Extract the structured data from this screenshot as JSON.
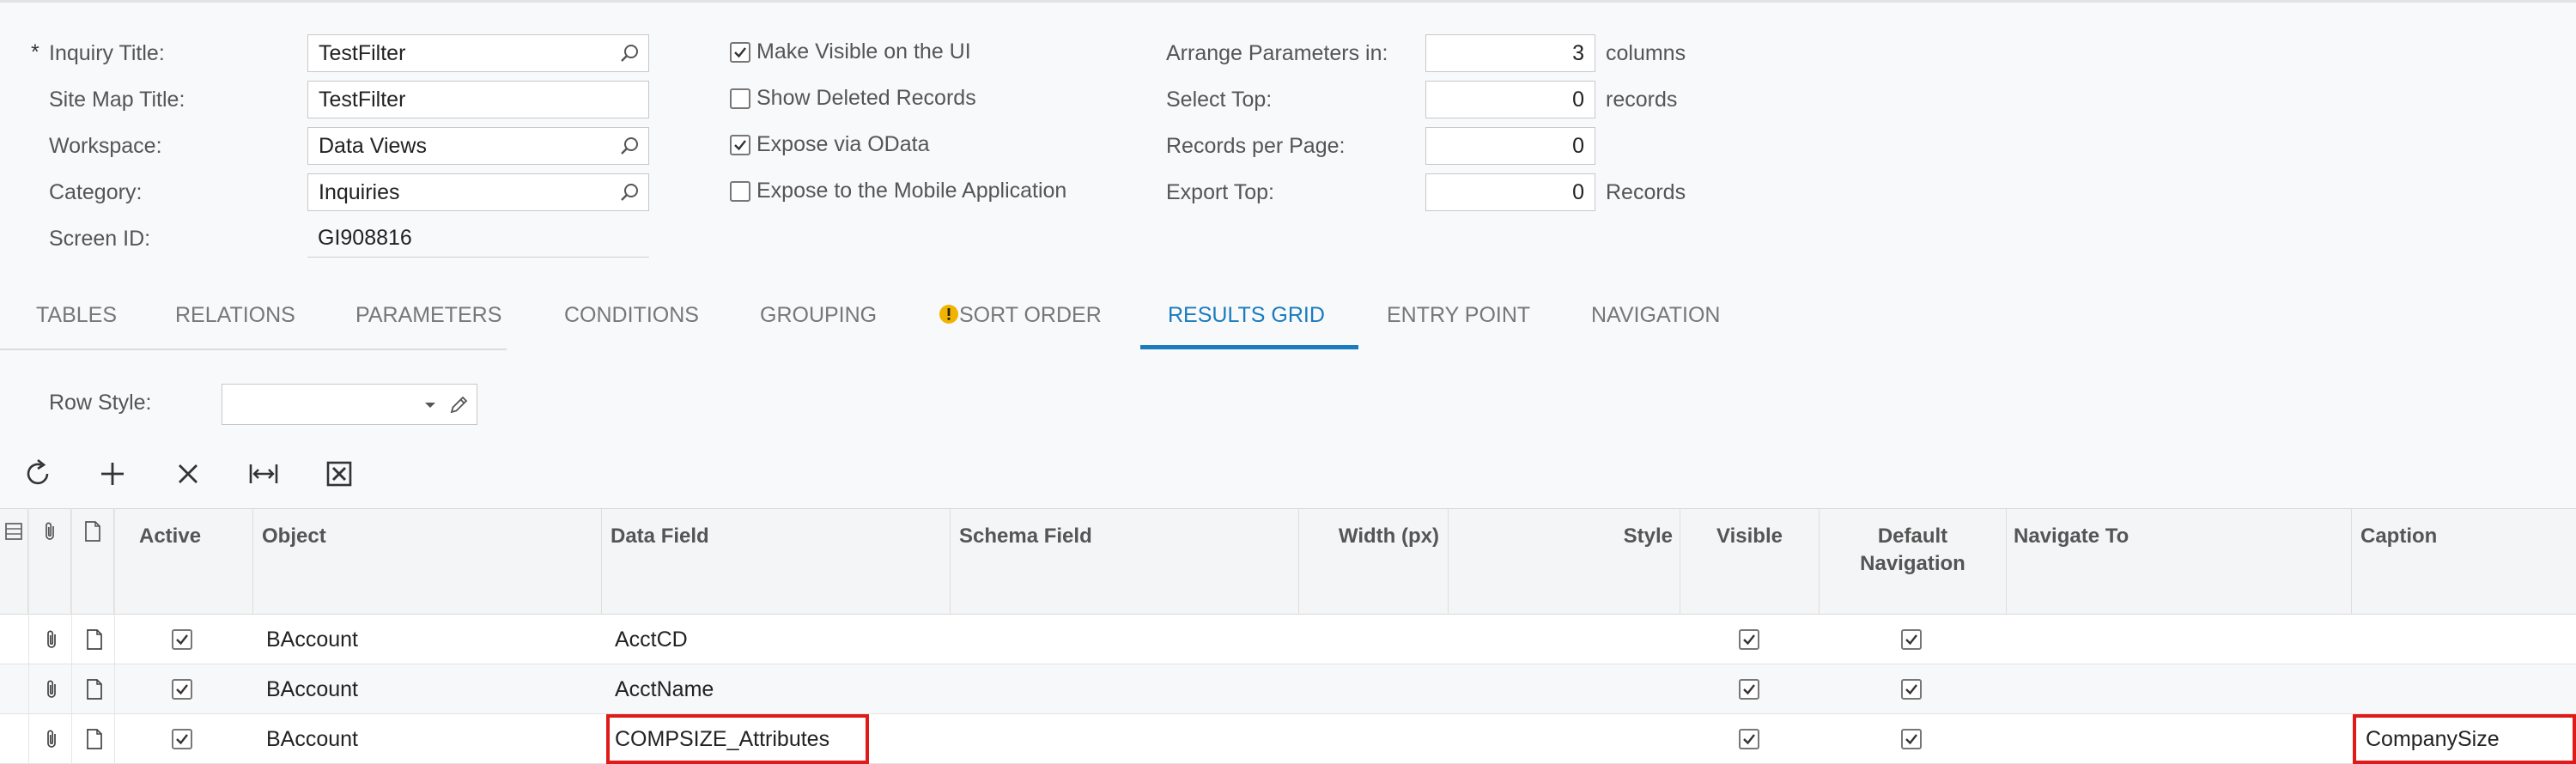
{
  "form": {
    "inquiry_title_label": "Inquiry Title:",
    "inquiry_title_value": "TestFilter",
    "site_map_title_label": "Site Map Title:",
    "site_map_title_value": "TestFilter",
    "workspace_label": "Workspace:",
    "workspace_value": "Data Views",
    "category_label": "Category:",
    "category_value": "Inquiries",
    "screen_id_label": "Screen ID:",
    "screen_id_value": "GI908816",
    "required_marker": "*"
  },
  "options": {
    "make_visible_label": "Make Visible on the UI",
    "make_visible_checked": true,
    "show_deleted_label": "Show Deleted Records",
    "show_deleted_checked": false,
    "expose_odata_label": "Expose via OData",
    "expose_odata_checked": true,
    "expose_mobile_label": "Expose to the Mobile Application",
    "expose_mobile_checked": false
  },
  "params": {
    "arrange_label": "Arrange Parameters in:",
    "arrange_value": "3",
    "arrange_unit": "columns",
    "select_top_label": "Select Top:",
    "select_top_value": "0",
    "select_top_unit": "records",
    "records_per_page_label": "Records per Page:",
    "records_per_page_value": "0",
    "export_top_label": "Export Top:",
    "export_top_value": "0",
    "export_top_unit": "Records"
  },
  "tabs": {
    "tables": "TABLES",
    "relations": "RELATIONS",
    "parameters": "PARAMETERS",
    "conditions": "CONDITIONS",
    "grouping": "GROUPING",
    "sort_order": "SORT ORDER",
    "results_grid": "RESULTS GRID",
    "entry_point": "ENTRY POINT",
    "navigation": "NAVIGATION",
    "active": "results_grid"
  },
  "row_style": {
    "label": "Row Style:",
    "value": ""
  },
  "grid": {
    "headers": {
      "active": "Active",
      "object": "Object",
      "data_field": "Data Field",
      "schema_field": "Schema Field",
      "width": "Width (px)",
      "style": "Style",
      "visible": "Visible",
      "default_nav_1": "Default",
      "default_nav_2": "Navigation",
      "navigate_to": "Navigate To",
      "caption": "Caption"
    },
    "rows": [
      {
        "active": true,
        "object": "BAccount",
        "data_field": "AcctCD",
        "visible": true,
        "default_navigation": true,
        "caption": ""
      },
      {
        "active": true,
        "object": "BAccount",
        "data_field": "AcctName",
        "visible": true,
        "default_navigation": true,
        "caption": ""
      },
      {
        "active": true,
        "object": "BAccount",
        "data_field": "COMPSIZE_Attributes",
        "visible": true,
        "default_navigation": true,
        "caption": "CompanySize"
      }
    ]
  },
  "colors": {
    "accent": "#1a7bbf",
    "highlight": "#e01919",
    "warning": "#f0b400"
  }
}
